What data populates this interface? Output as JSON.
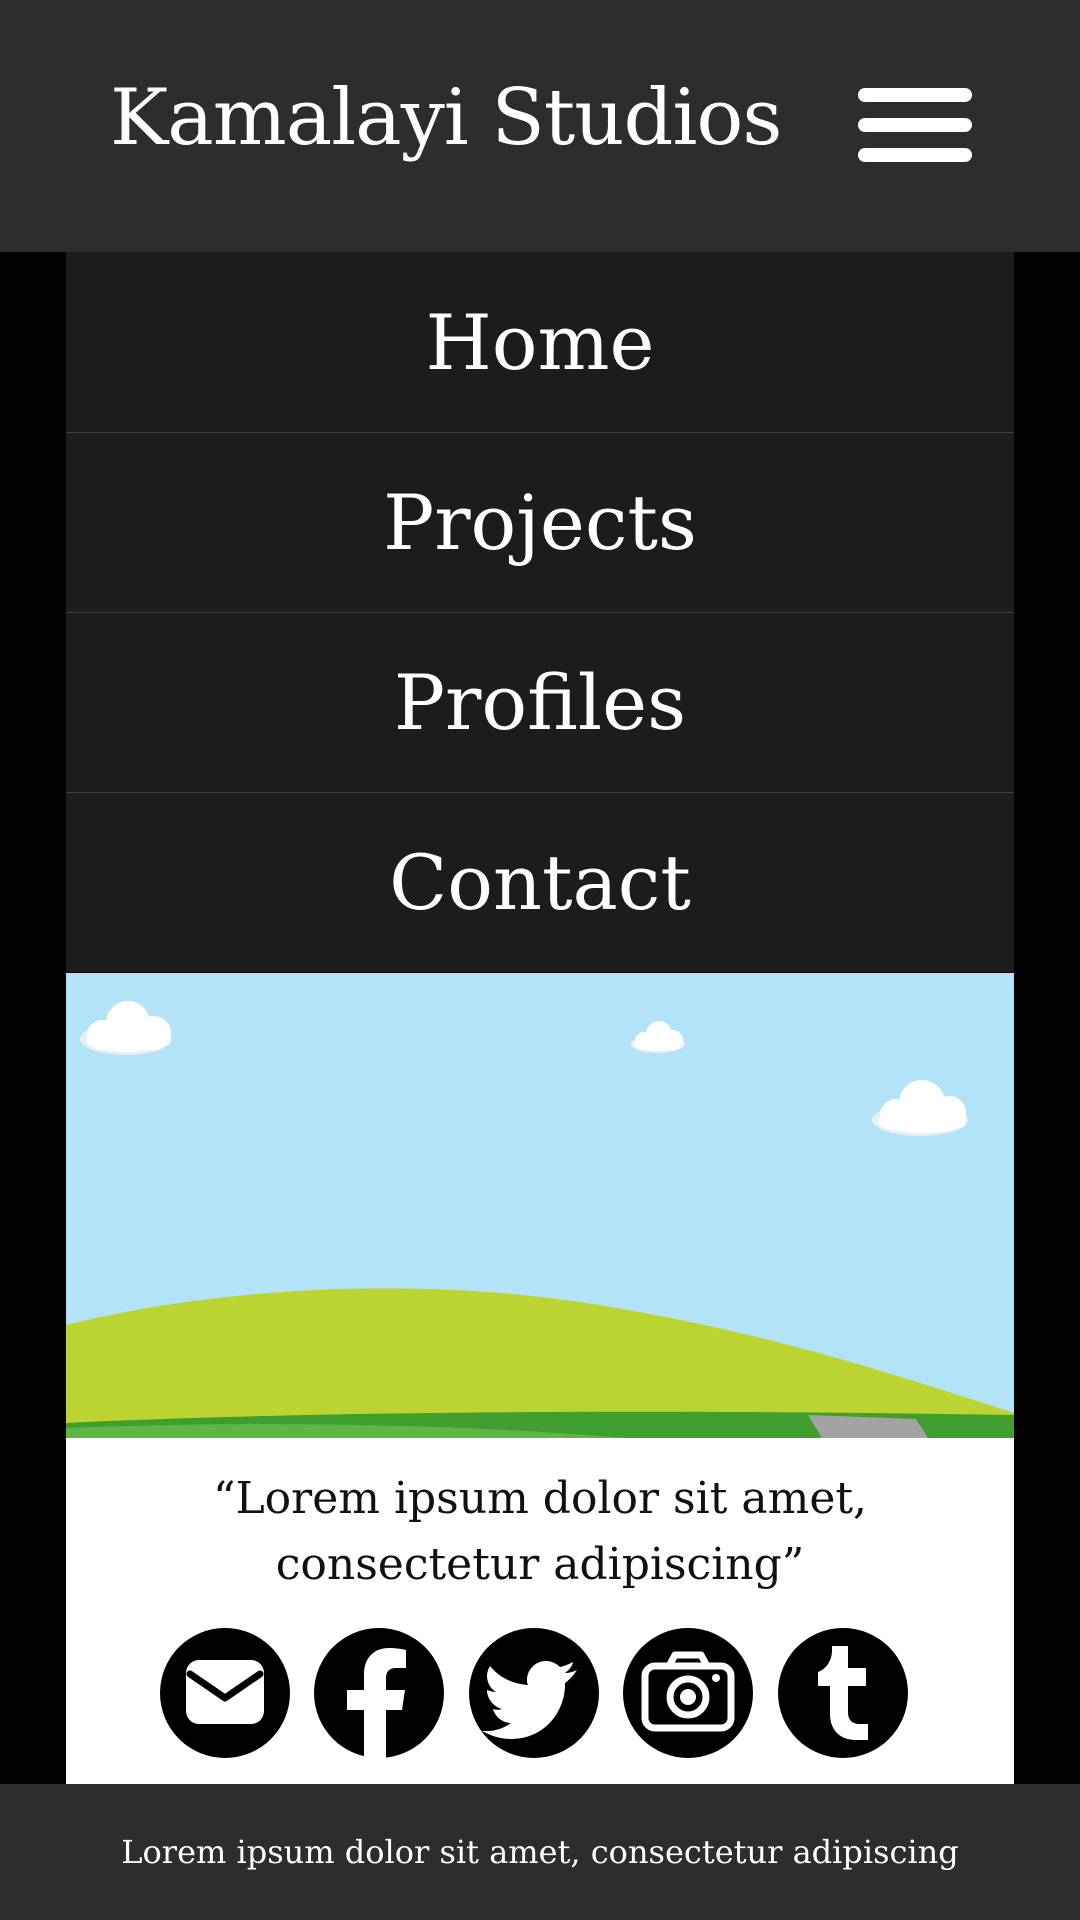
{
  "header": {
    "title": "Kamalayi Studios",
    "menu_icon": "hamburger-menu-icon"
  },
  "nav": {
    "items": [
      {
        "label": "Home"
      },
      {
        "label": "Projects"
      },
      {
        "label": "Profiles"
      },
      {
        "label": "Contact"
      }
    ]
  },
  "banner": {
    "description_icon": "landscape-illustration",
    "colors": {
      "sky": "#b3e3f8",
      "hill": "#bbd432",
      "grass": "#3f9e2e",
      "road": "#a3a3a3",
      "cloud": "#ffffff"
    }
  },
  "quote": {
    "line1": "“Lorem ipsum dolor sit amet,",
    "line2": "consectetur adipiscing”"
  },
  "social": {
    "icons": [
      "envelope-icon",
      "facebook-icon",
      "twitter-icon",
      "camera-icon",
      "tumblr-icon"
    ]
  },
  "footer": {
    "text": "Lorem ipsum dolor sit amet, consectetur adipiscing"
  },
  "colors": {
    "header_bg": "#2d2d2e",
    "nav_bg": "#1d1c1c",
    "page_bg": "#000000"
  }
}
